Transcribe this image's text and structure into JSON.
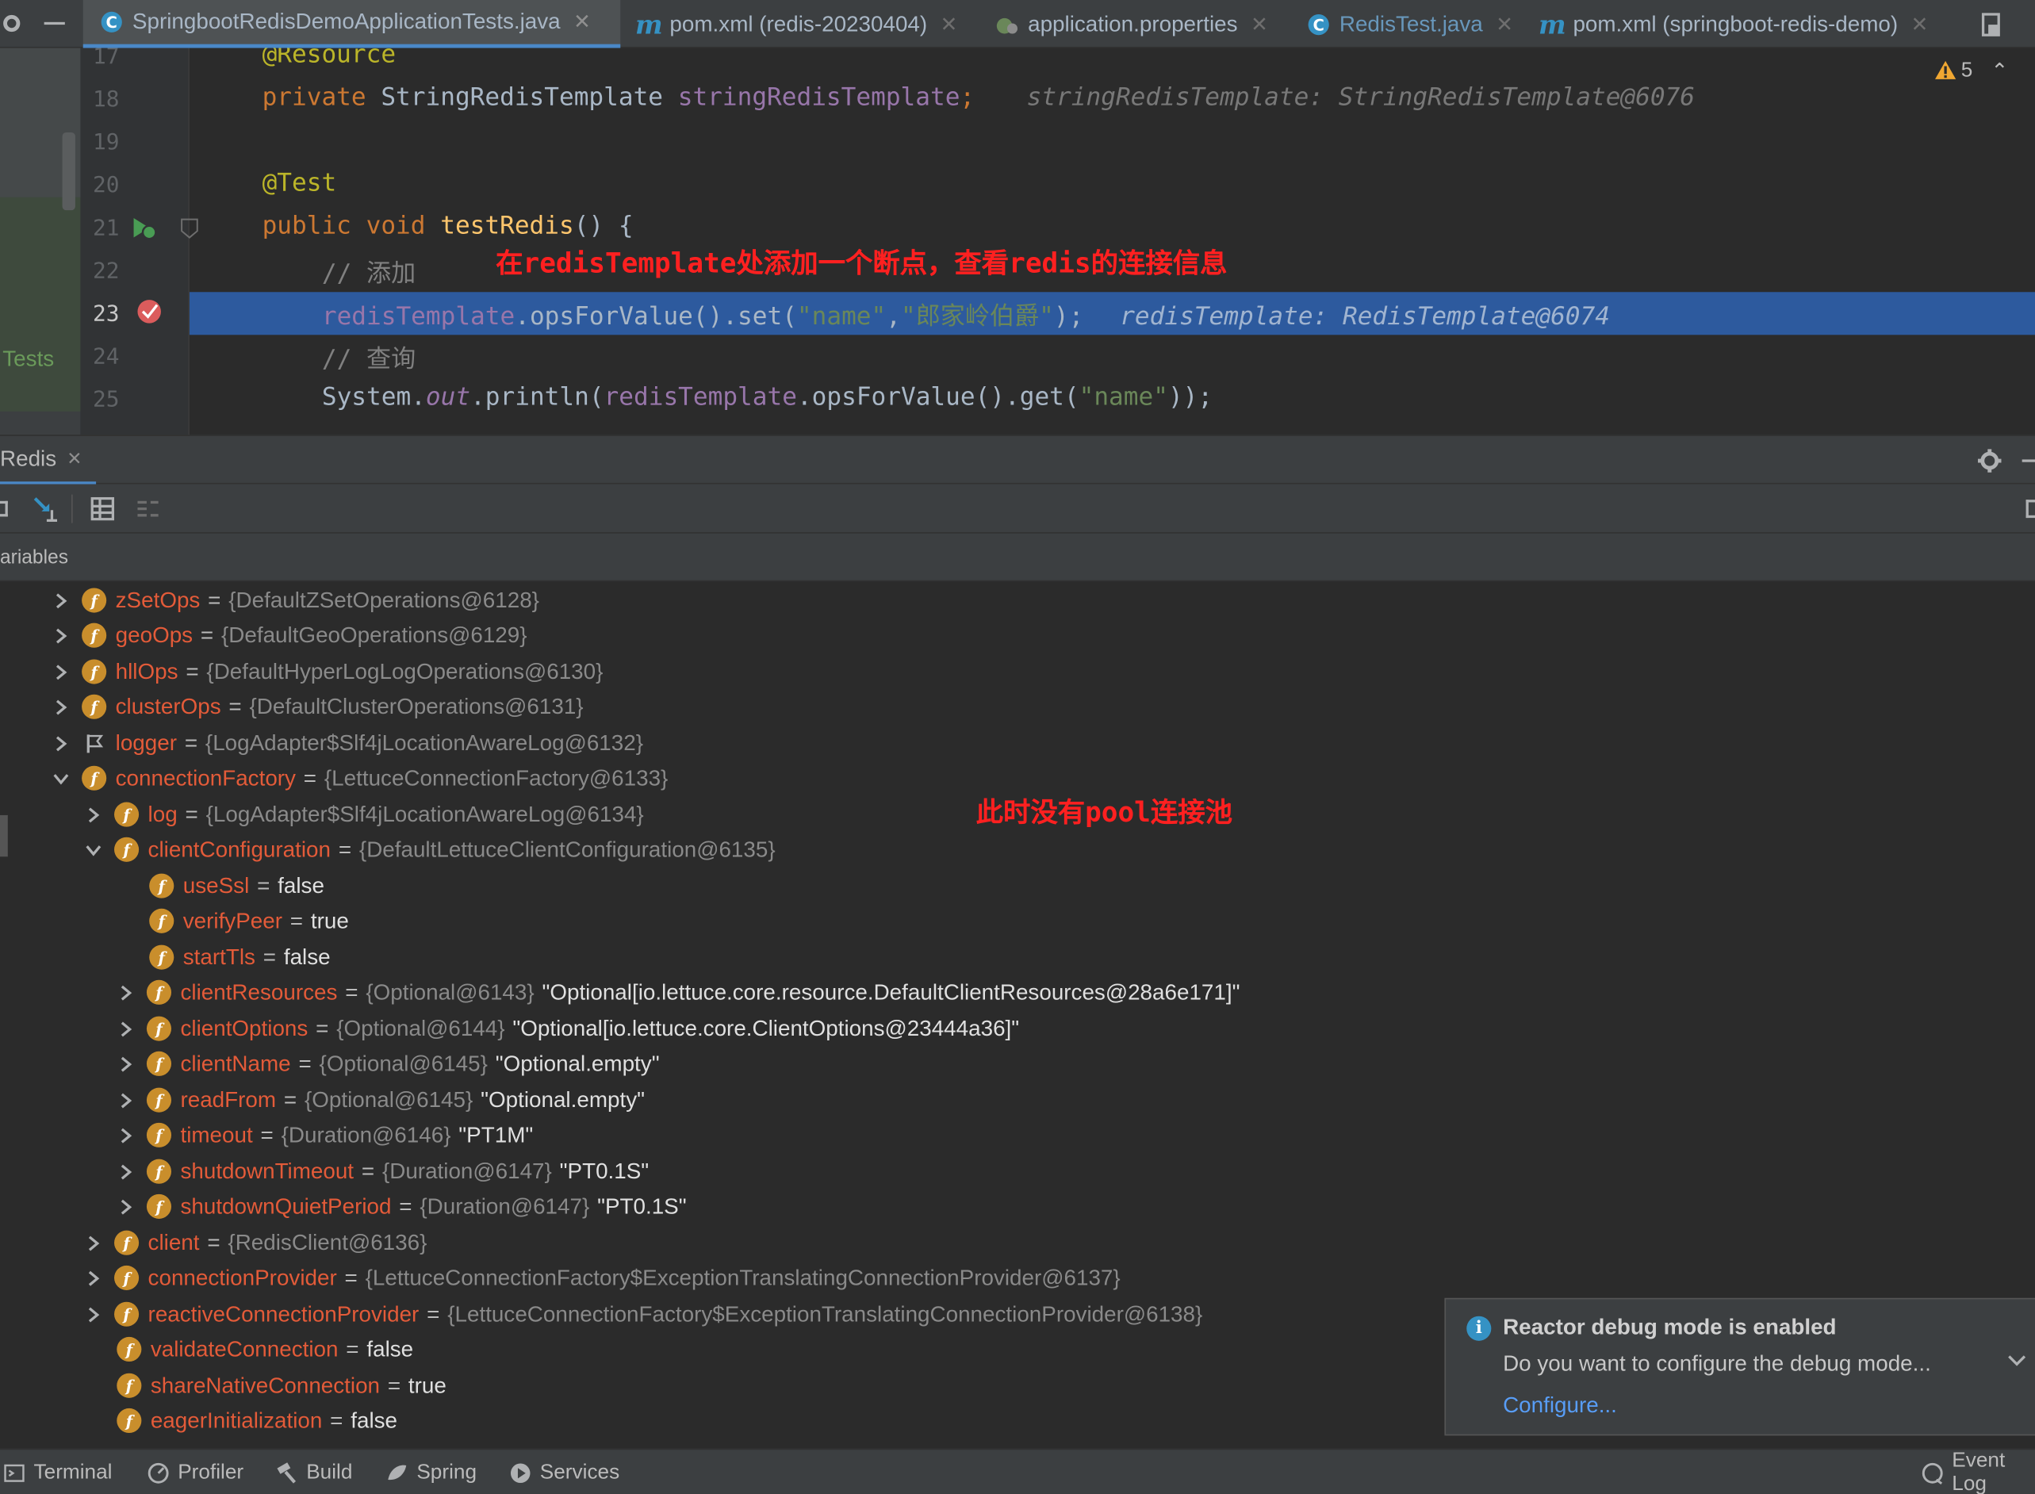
{
  "tabs": [
    {
      "label": "SpringbootRedisDemoApplicationTests.java",
      "icon": "java-class-icon"
    },
    {
      "label": "pom.xml (redis-20230404)",
      "icon": "maven-icon"
    },
    {
      "label": "application.properties",
      "icon": "spring-properties-icon"
    },
    {
      "label": "RedisTest.java",
      "icon": "java-class-icon"
    },
    {
      "label": "pom.xml (springboot-redis-demo)",
      "icon": "maven-icon"
    }
  ],
  "editor": {
    "warnings_count": "5",
    "project_label": "Tests",
    "lines": [
      {
        "no": "17",
        "text": "@Resource"
      },
      {
        "no": "18",
        "text": "private StringRedisTemplate stringRedisTemplate;",
        "hint": "stringRedisTemplate: StringRedisTemplate@6076"
      },
      {
        "no": "19",
        "text": ""
      },
      {
        "no": "20",
        "text": "@Test"
      },
      {
        "no": "21",
        "text": "public void testRedis() {"
      },
      {
        "no": "22",
        "text": "// 添加"
      },
      {
        "no": "23",
        "text": "redisTemplate.opsForValue().set(\"name\",\"郎家岭伯爵\");",
        "hint": "redisTemplate: RedisTemplate@6074"
      },
      {
        "no": "24",
        "text": "// 查询"
      },
      {
        "no": "25",
        "text": "System.out.println(redisTemplate.opsForValue().get(\"name\"));"
      }
    ],
    "annotation_top": "在redisTemplate处添加一个断点，查看redis的连接信息"
  },
  "debug": {
    "tab_label": "Redis",
    "variables_header": "ariables",
    "annotation_tree": "此时没有pool连接池",
    "rows": [
      {
        "name": "zSetOps",
        "type": "{DefaultZSetOperations@6128}",
        "value": ""
      },
      {
        "name": "geoOps",
        "type": "{DefaultGeoOperations@6129}",
        "value": ""
      },
      {
        "name": "hllOps",
        "type": "{DefaultHyperLogLogOperations@6130}",
        "value": ""
      },
      {
        "name": "clusterOps",
        "type": "{DefaultClusterOperations@6131}",
        "value": ""
      },
      {
        "name": "logger",
        "type": "{LogAdapter$Slf4jLocationAwareLog@6132}",
        "value": ""
      },
      {
        "name": "connectionFactory",
        "type": "{LettuceConnectionFactory@6133}",
        "value": ""
      },
      {
        "name": "log",
        "type": "{LogAdapter$Slf4jLocationAwareLog@6134}",
        "value": ""
      },
      {
        "name": "clientConfiguration",
        "type": "{DefaultLettuceClientConfiguration@6135}",
        "value": ""
      },
      {
        "name": "useSsl",
        "type": "",
        "value": "false"
      },
      {
        "name": "verifyPeer",
        "type": "",
        "value": "true"
      },
      {
        "name": "startTls",
        "type": "",
        "value": "false"
      },
      {
        "name": "clientResources",
        "type": "{Optional@6143}",
        "value": "\"Optional[io.lettuce.core.resource.DefaultClientResources@28a6e171]\""
      },
      {
        "name": "clientOptions",
        "type": "{Optional@6144}",
        "value": "\"Optional[io.lettuce.core.ClientOptions@23444a36]\""
      },
      {
        "name": "clientName",
        "type": "{Optional@6145}",
        "value": "\"Optional.empty\""
      },
      {
        "name": "readFrom",
        "type": "{Optional@6145}",
        "value": "\"Optional.empty\""
      },
      {
        "name": "timeout",
        "type": "{Duration@6146}",
        "value": "\"PT1M\""
      },
      {
        "name": "shutdownTimeout",
        "type": "{Duration@6147}",
        "value": "\"PT0.1S\""
      },
      {
        "name": "shutdownQuietPeriod",
        "type": "{Duration@6147}",
        "value": "\"PT0.1S\""
      },
      {
        "name": "client",
        "type": "{RedisClient@6136}",
        "value": ""
      },
      {
        "name": "connectionProvider",
        "type": "{LettuceConnectionFactory$ExceptionTranslatingConnectionProvider@6137}",
        "value": ""
      },
      {
        "name": "reactiveConnectionProvider",
        "type": "{LettuceConnectionFactory$ExceptionTranslatingConnectionProvider@6138}",
        "value": ""
      },
      {
        "name": "validateConnection",
        "type": "",
        "value": "false"
      },
      {
        "name": "shareNativeConnection",
        "type": "",
        "value": "true"
      },
      {
        "name": "eagerInitialization",
        "type": "",
        "value": "false"
      }
    ]
  },
  "notification": {
    "title": "Reactor debug mode is enabled",
    "body": "Do you want to configure the debug mode...",
    "link": "Configure..."
  },
  "bottombar": {
    "items": [
      "Terminal",
      "Profiler",
      "Build",
      "Spring",
      "Services",
      "Event Log"
    ]
  },
  "colors": {
    "accent": "#4a88c7",
    "selection": "#2d5a9e",
    "field_name": "#e35b39",
    "annotation_red": "#ff2020"
  }
}
